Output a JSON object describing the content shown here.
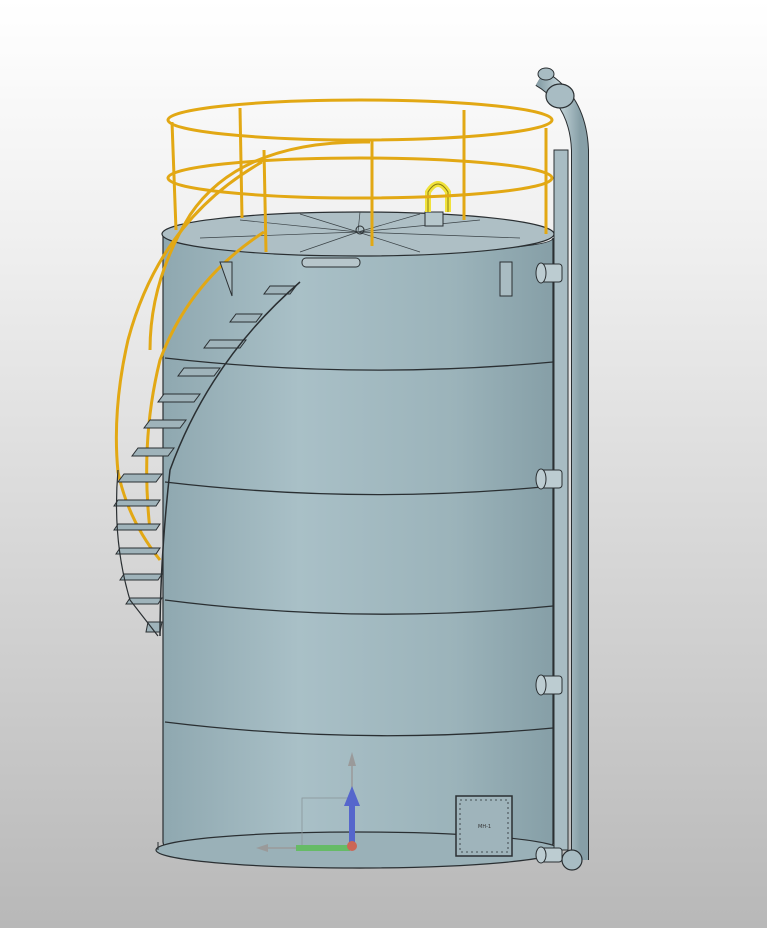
{
  "scene": {
    "description_type": "3d-cad-viewport",
    "colors": {
      "tank_body": "#9fb6bd",
      "tank_top": "#a9bcc2",
      "railing": "#e2a814",
      "lifting_lug": "#f1e23a",
      "pipe": "#a8bcc3",
      "outline": "#2a2f32"
    },
    "manhole_plate_text": "MH-1",
    "gizmo": {
      "z_axis_color": "#5566cc",
      "y_axis_color": "#66bb66",
      "x_axis_color": "#cc6655",
      "ghost_axis_color": "#9a9a9a"
    },
    "nozzle_count": 4,
    "stair_tread_count": 14
  }
}
